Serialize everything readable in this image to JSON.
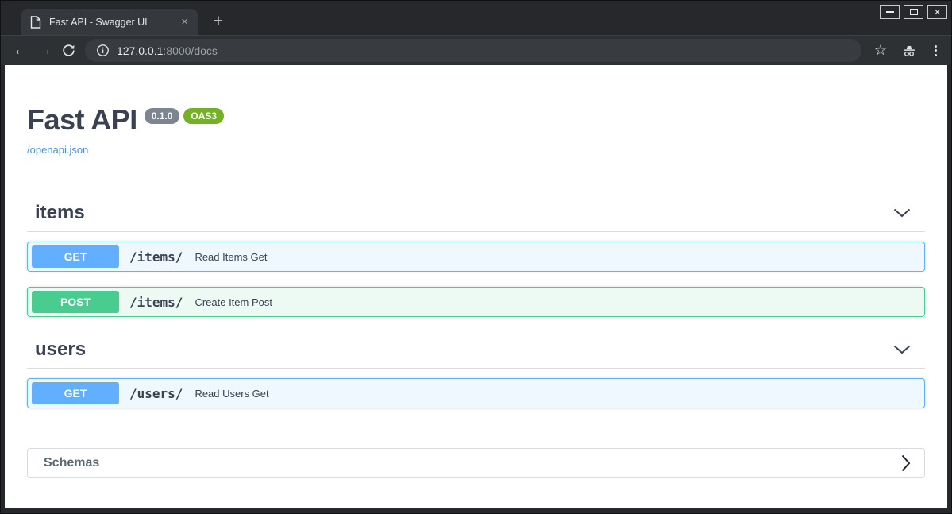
{
  "window": {
    "tab": {
      "title": "Fast API - Swagger UI",
      "close_glyph": "×"
    },
    "new_tab_glyph": "+",
    "controls": {
      "close_glyph": "×"
    }
  },
  "toolbar": {
    "back_glyph": "←",
    "forward_glyph": "→",
    "star_glyph": "☆",
    "url": {
      "host": "127.0.0.1",
      "rest": ":8000/docs"
    }
  },
  "info": {
    "title": "Fast API",
    "version": "0.1.0",
    "oas": "OAS3",
    "spec_link": "/openapi.json"
  },
  "sections": [
    {
      "name": "items",
      "operations": [
        {
          "method": "GET",
          "path": "/items/",
          "summary": "Read Items Get",
          "style": "get"
        },
        {
          "method": "POST",
          "path": "/items/",
          "summary": "Create Item Post",
          "style": "post"
        }
      ]
    },
    {
      "name": "users",
      "operations": [
        {
          "method": "GET",
          "path": "/users/",
          "summary": "Read Users Get",
          "style": "get"
        }
      ]
    }
  ],
  "schemas": {
    "label": "Schemas"
  },
  "colors": {
    "get_blue": "#61affe",
    "post_green": "#49cc90",
    "oas_badge_green": "#74b126",
    "version_badge_gray": "#7d8492",
    "link_blue": "#4990e2",
    "heading_text": "#3b4151",
    "browser_dark": "#2d3134"
  }
}
